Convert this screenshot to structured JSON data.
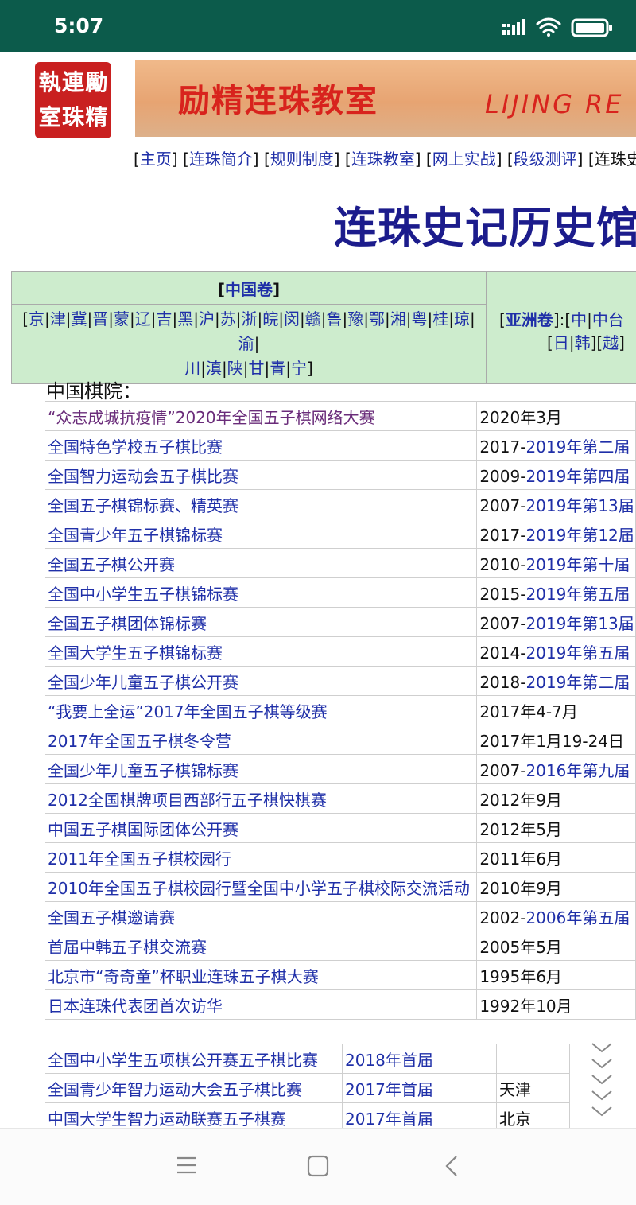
{
  "status_bar": {
    "time": "5:07",
    "icons": [
      "signal-icon",
      "wifi-icon",
      "battery-icon"
    ]
  },
  "header": {
    "seal_chars": [
      "勵",
      "連",
      "執",
      "精",
      "珠",
      "室"
    ],
    "banner_cn": "励精连珠教室",
    "banner_en": "LIJING RE"
  },
  "topnav": {
    "items": [
      "主页",
      "连珠简介",
      "规则制度",
      "连珠教室",
      "网上实战",
      "段级测评",
      "连珠史"
    ]
  },
  "page_title": "连珠史记历史馆藏",
  "regions": {
    "china_label": "中国卷",
    "provinces_row1": [
      "京",
      "津",
      "冀",
      "晋",
      "蒙",
      "辽",
      "吉",
      "黑",
      "沪",
      "苏",
      "浙",
      "皖",
      "闵",
      "赣",
      "鲁",
      "豫",
      "鄂",
      "湘",
      "粤",
      "桂",
      "琼",
      "渝"
    ],
    "provinces_row2": [
      "川",
      "滇",
      "陕",
      "甘",
      "青",
      "宁"
    ],
    "asia_label": "亚洲卷",
    "asia_row1": [
      "中",
      "中台"
    ],
    "asia_row2": [
      "日",
      "韩",
      "越"
    ]
  },
  "section": {
    "title": "中国棋院："
  },
  "tournaments": [
    {
      "name": "“众志成城抗疫情”2020年全国五子棋网络大赛",
      "date": "2020年3月",
      "date_link": "",
      "visited": true
    },
    {
      "name": "全国特色学校五子棋比赛",
      "date": "2017-",
      "date_link": "2019年第二届"
    },
    {
      "name": "全国智力运动会五子棋比赛",
      "date": "2009-",
      "date_link": "2019年第四届"
    },
    {
      "name": "全国五子棋锦标赛、精英赛",
      "date": "2007-",
      "date_link": "2019年第13届"
    },
    {
      "name": "全国青少年五子棋锦标赛",
      "date": "2017-",
      "date_link": "2019年第12届"
    },
    {
      "name": "全国五子棋公开赛",
      "date": "2010-",
      "date_link": "2019年第十届"
    },
    {
      "name": "全国中小学生五子棋锦标赛",
      "date": "2015-",
      "date_link": "2019年第五届"
    },
    {
      "name": "全国五子棋团体锦标赛",
      "date": "2007-",
      "date_link": "2019年第13届"
    },
    {
      "name": "全国大学生五子棋锦标赛",
      "date": "2014-",
      "date_link": "2019年第五届"
    },
    {
      "name": "全国少年儿童五子棋公开赛",
      "date": "2018-",
      "date_link": "2019年第二届"
    },
    {
      "name": "“我要上全运”2017年全国五子棋等级赛",
      "date": "2017年4-7月",
      "date_link": ""
    },
    {
      "name": "2017年全国五子棋冬令营",
      "date": "2017年1月19-24日",
      "date_link": ""
    },
    {
      "name": "全国少年儿童五子棋锦标赛",
      "date": "2007-",
      "date_link": "2016年第九届"
    },
    {
      "name": "2012全国棋牌项目西部行五子棋快棋赛",
      "date": "2012年9月",
      "date_link": ""
    },
    {
      "name": "中国五子棋国际团体公开赛",
      "date": "2012年5月",
      "date_link": ""
    },
    {
      "name": "2011年全国五子棋校园行",
      "date": "2011年6月",
      "date_link": ""
    },
    {
      "name": "2010年全国五子棋校园行暨全国中小学五子棋校际交流活动",
      "date": "2010年9月",
      "date_link": ""
    },
    {
      "name": "全国五子棋邀请赛",
      "date": "2002-",
      "date_link": "2006年第五届"
    },
    {
      "name": "首届中韩五子棋交流赛",
      "date": "2005年5月",
      "date_link": ""
    },
    {
      "name": "北京市“奇奇童”杯职业连珠五子棋大赛",
      "date": "1995年6月",
      "date_link": ""
    },
    {
      "name": "日本连珠代表团首次访华",
      "date": "1992年10月",
      "date_link": ""
    }
  ],
  "tournaments2": [
    {
      "name": "全国中小学生五项棋公开赛五子棋比赛",
      "edition": "2018年首届",
      "place": ""
    },
    {
      "name": "全国青少年智力运动大会五子棋比赛",
      "edition": "2017年首届",
      "place": "天津"
    },
    {
      "name": "中国大学生智力运动联赛五子棋赛",
      "edition": "2017年首届",
      "place": "北京"
    }
  ],
  "nav_buttons": [
    "menu-icon",
    "home-icon",
    "back-icon"
  ]
}
